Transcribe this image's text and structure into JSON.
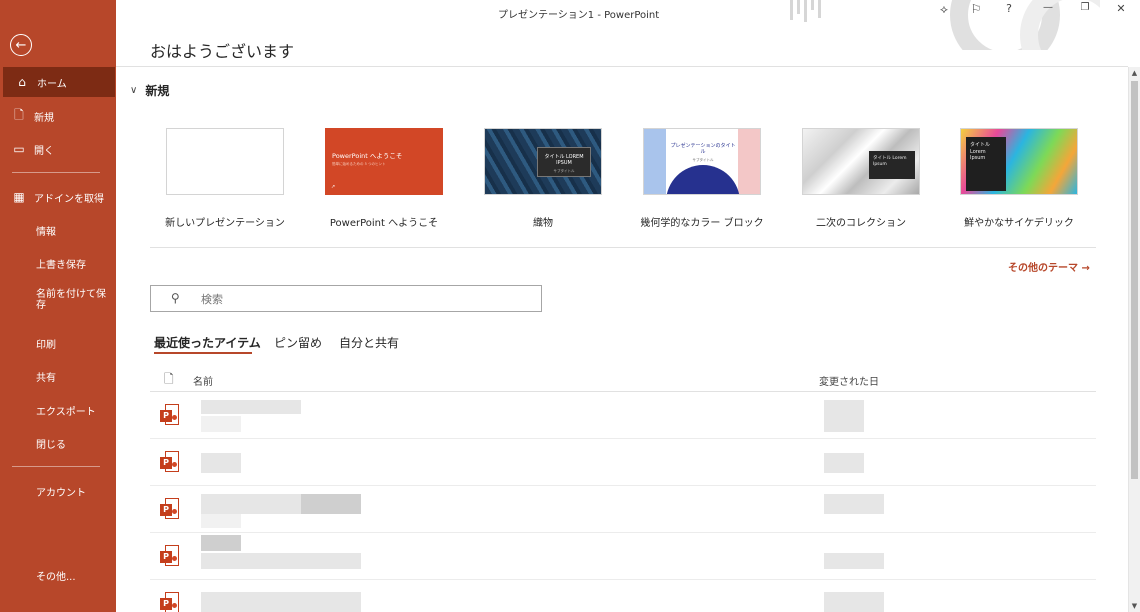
{
  "window": {
    "title": "プレゼンテーション1  -  PowerPoint"
  },
  "titlebar_icons": [
    "diamond-icon",
    "coauthor-icon",
    "help-icon",
    "minimize-icon",
    "restore-icon",
    "close-icon"
  ],
  "titlebar_glyphs": {
    "diamond": "⟡",
    "coauthor": "⚐",
    "help": "?",
    "minimize": "—",
    "restore": "❐",
    "close": "✕"
  },
  "sidebar": {
    "back_glyph": "←",
    "home": "ホーム",
    "new": "新規",
    "open": "開く",
    "addins": "アドインを取得",
    "info": "情報",
    "save": "上書き保存",
    "save_as": "名前を付けて保存",
    "print": "印刷",
    "share": "共有",
    "export": "エクスポート",
    "close": "閉じる",
    "account": "アカウント",
    "more": "その他..."
  },
  "header": {
    "greeting": "おはようございます"
  },
  "new_section": {
    "title": "新規",
    "templates": [
      {
        "label": "新しいプレゼンテーション"
      },
      {
        "label": "PowerPoint へようこそ",
        "thumb_title": "PowerPoint へようこそ",
        "thumb_sub": "簡単に始めるための 5 つのヒント",
        "thumb_mark": "↗"
      },
      {
        "label": "織物",
        "thumb_text": "タイトル LOREM IPSUM",
        "thumb_sub": "サブタイトル"
      },
      {
        "label": "幾何学的なカラー ブロック",
        "thumb_text": "プレゼンテーションのタイトル",
        "thumb_sub": "サブタイトル"
      },
      {
        "label": "二次のコレクション",
        "thumb_text": "タイトル Lorem Ipsum"
      },
      {
        "label": "鮮やかなサイケデリック",
        "thumb_text": "タイトル Lorem Ipsum"
      }
    ],
    "more_themes": "その他のテーマ →"
  },
  "search": {
    "placeholder": "検索",
    "value": ""
  },
  "tabs": {
    "recent": "最近使ったアイテム",
    "pinned": "ピン留め",
    "shared": "自分と共有"
  },
  "file_list": {
    "col_name": "名前",
    "col_modified": "変更された日",
    "rows": [
      {
        "icon": "pptx-file-icon"
      },
      {
        "icon": "pptx-file-icon"
      },
      {
        "icon": "pptx-file-icon"
      },
      {
        "icon": "pptx-file-icon"
      },
      {
        "icon": "pptx-file-icon"
      }
    ]
  },
  "colors": {
    "accent": "#b7472a",
    "sidebar_active": "#7d2b14"
  }
}
